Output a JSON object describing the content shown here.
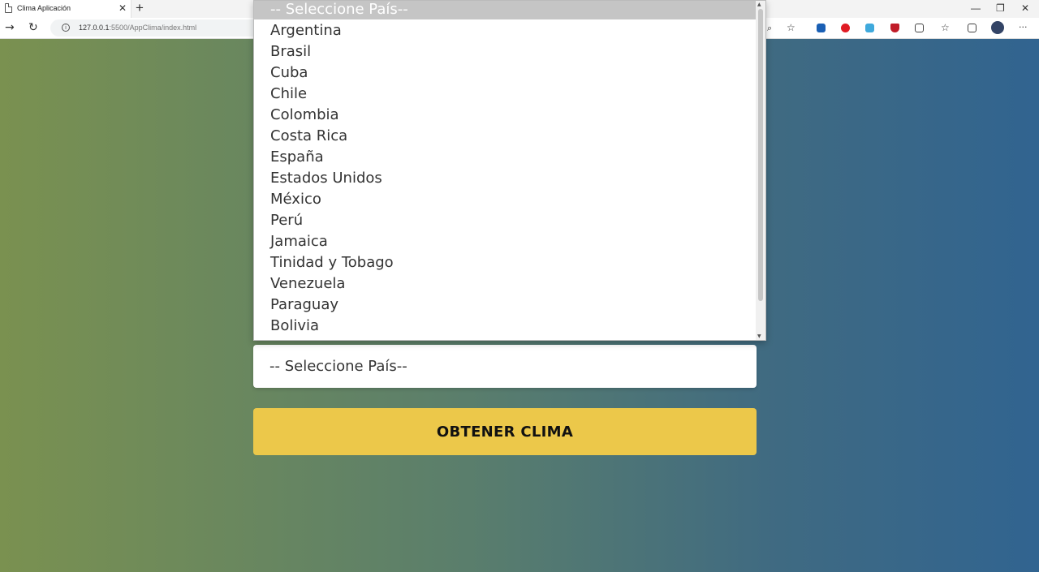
{
  "browser": {
    "tab_title": "Clima Aplicación",
    "tab_close": "✕",
    "new_tab": "+",
    "url_host": "127.0.0.1",
    "url_path": ":5500/AppClima/index.html",
    "win_minimize": "—",
    "win_restore": "❐",
    "win_close": "✕",
    "more": "···"
  },
  "page": {
    "country_select_value": "-- Seleccione País--",
    "submit_label": "OBTENER CLIMA"
  },
  "dropdown": {
    "selected_option": "-- Seleccione País--",
    "options": [
      "Argentina",
      "Brasil",
      "Cuba",
      "Chile",
      "Colombia",
      "Costa Rica",
      "España",
      "Estados Unidos",
      "México",
      "Perú",
      "Jamaica",
      "Tinidad y Tobago",
      "Venezuela",
      "Paraguay",
      "Bolivia"
    ]
  },
  "colors": {
    "gradient_start": "#7a9150",
    "gradient_end": "#316490",
    "button": "#ecc84a"
  }
}
